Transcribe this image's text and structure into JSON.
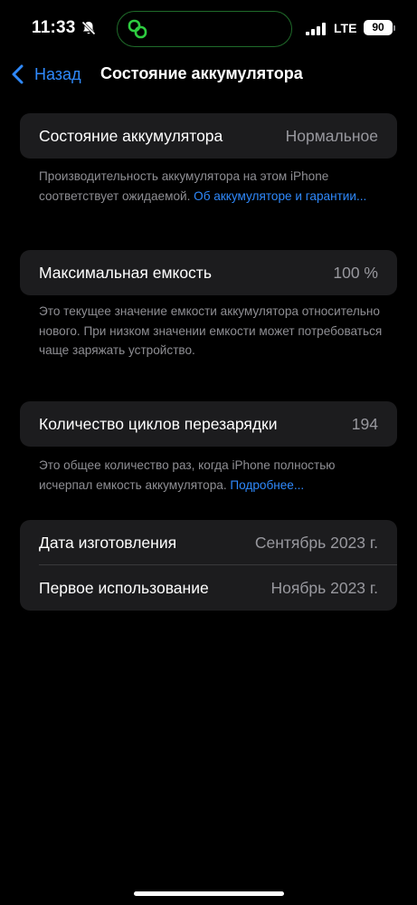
{
  "status_bar": {
    "time": "11:33",
    "network": "LTE",
    "battery": "90",
    "icons": [
      "bell-slash-icon",
      "link-rings-icon",
      "signal-icon"
    ]
  },
  "nav": {
    "back_label": "Назад",
    "title": "Состояние аккумулятора"
  },
  "battery_health": {
    "label": "Состояние аккумулятора",
    "value": "Нормальное",
    "footer": "Производительность аккумулятора на этом iPhone соответствует ожидаемой. ",
    "footer_link": "Об аккумуляторе и гарантии..."
  },
  "max_capacity": {
    "label": "Максимальная емкость",
    "value": "100 %",
    "footer": "Это текущее значение емкости аккумулятора относительно нового. При низком значении емкости может потребоваться чаще заряжать устройство."
  },
  "cycle_count": {
    "label": "Количество циклов перезарядки",
    "value": "194",
    "footer": "Это общее количество раз, когда iPhone полностью исчерпал емкость аккумулятора. ",
    "footer_link": "Подробнее..."
  },
  "dates": {
    "manufactured_label": "Дата изготовления",
    "manufactured_value": "Сентябрь 2023 г.",
    "first_use_label": "Первое использование",
    "first_use_value": "Ноябрь 2023 г."
  },
  "colors": {
    "background": "#000000",
    "cell": "#1c1c1e",
    "accent": "#2f89fc",
    "secondary_text": "#98989e",
    "island_ring": "#2ecc40"
  }
}
